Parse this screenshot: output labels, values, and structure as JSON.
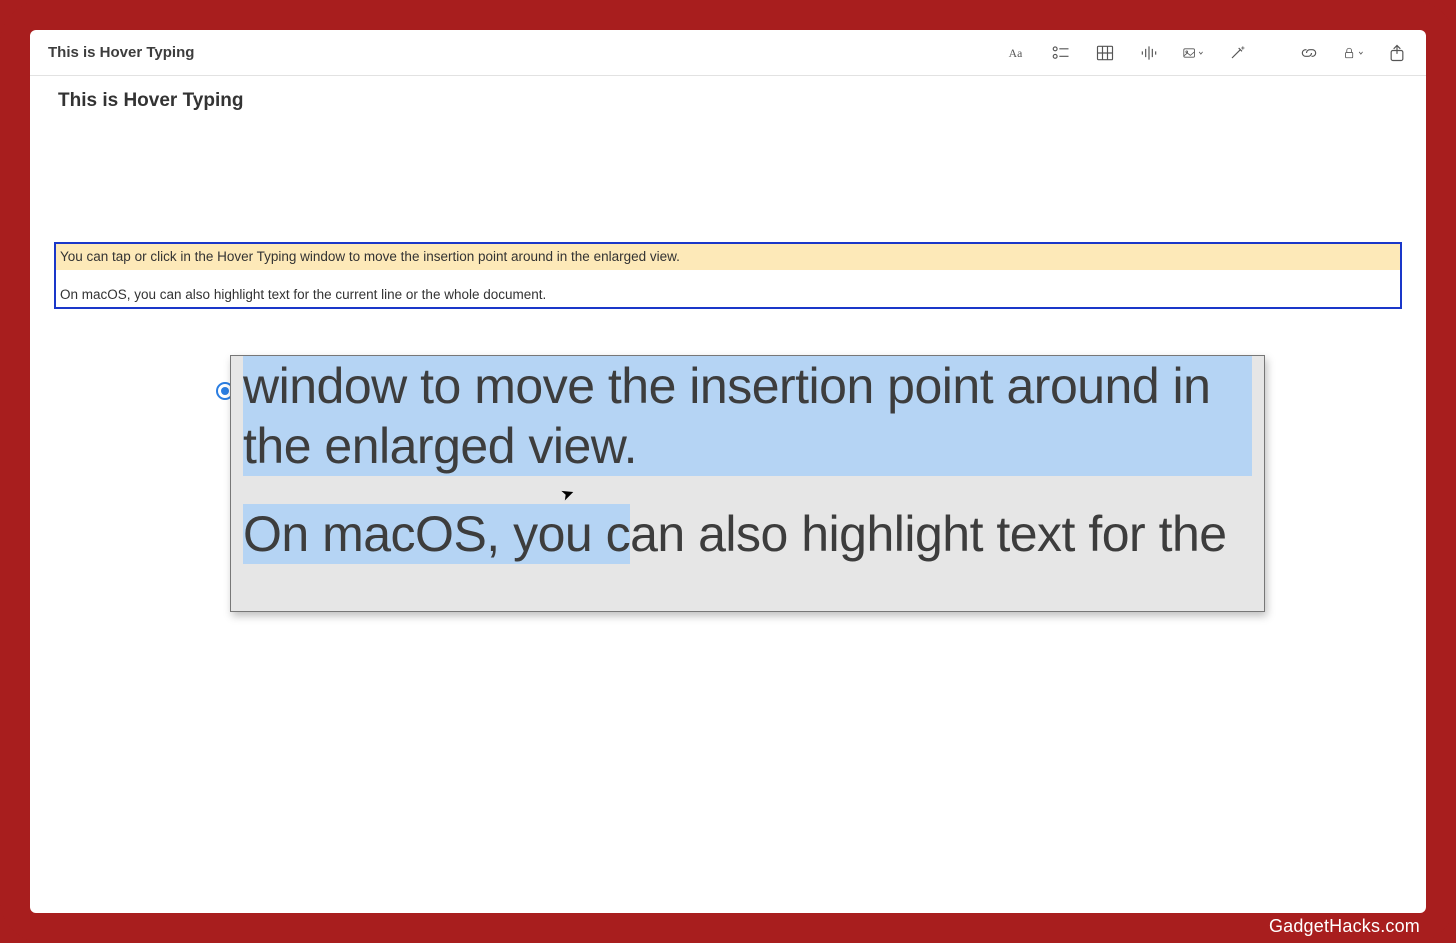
{
  "toolbar": {
    "title": "This is Hover Typing",
    "icons": {
      "format": "format-icon",
      "checklist": "checklist-icon",
      "table": "table-icon",
      "audio": "audio-icon",
      "media": "media-icon",
      "wand": "wand-icon",
      "link": "link-icon",
      "lock": "lock-icon",
      "share": "share-icon"
    }
  },
  "document": {
    "title": "This is Hover Typing",
    "paragraph1": "You can tap or click in the Hover Typing window to move the insertion point around in the enlarged view.",
    "paragraph2": "On macOS, you can also highlight text for the current line or the whole document."
  },
  "hover_panel": {
    "line1": "window to move the insertion point around in the enlarged view.",
    "line2_highlighted": "On macOS, you c",
    "line2_rest": "an also highlight text for the"
  },
  "watermark": "GadgetHacks.com"
}
